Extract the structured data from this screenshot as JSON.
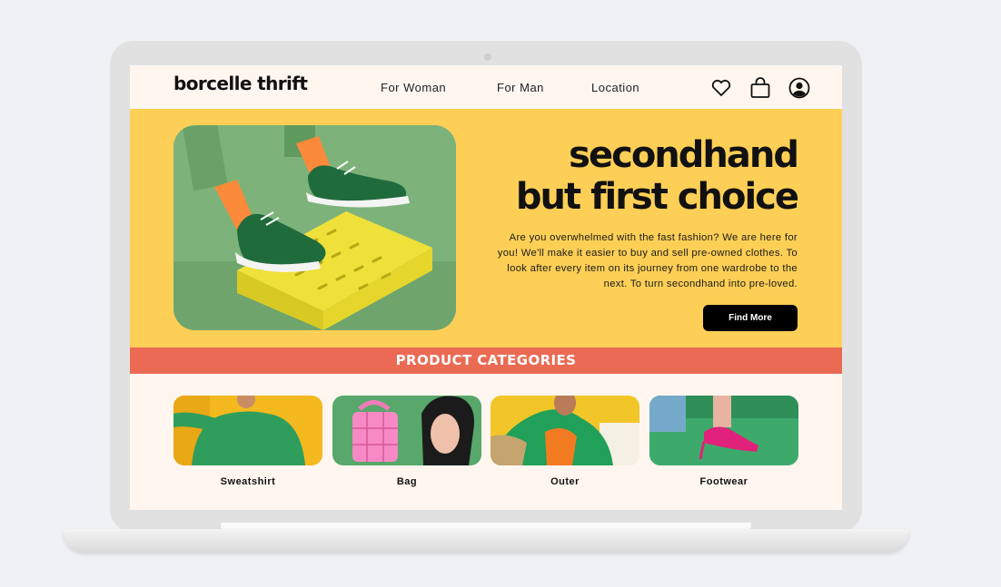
{
  "brand": {
    "name": "borcelle thrift"
  },
  "nav": {
    "links": [
      "For Woman",
      "For Man",
      "Location"
    ],
    "icons": [
      "heart-icon",
      "shopping-bag-icon",
      "user-account-icon"
    ]
  },
  "hero": {
    "title_line1": "secondhand",
    "title_line2": "but first choice",
    "description": "Are you overwhelmed with the fast fashion? We are here for you! We'll make it easier to buy and sell pre-owned clothes. To look after every item on its journey from one wardrobe to the next. To turn secondhand into pre-loved.",
    "cta_label": "Find More"
  },
  "categories": {
    "heading": "PRODUCT CATEGORIES",
    "items": [
      "Sweatshirt",
      "Bag",
      "Outer",
      "Footwear"
    ]
  },
  "colors": {
    "page_background": "#fef6ef",
    "hero_background": "#fecf56",
    "category_band": "#ea6a53",
    "cta_background": "#000000",
    "laptop_frame": "#e1e1e1"
  }
}
